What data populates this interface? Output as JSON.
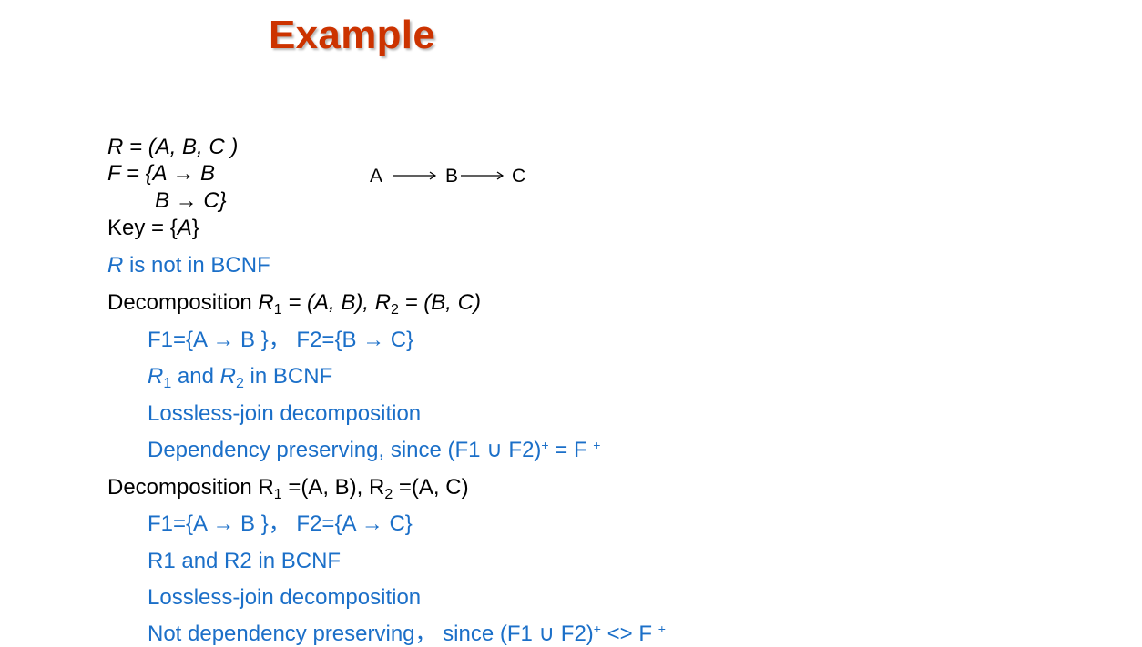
{
  "title": "Example",
  "relation": {
    "r_label": "R",
    "r_rest": " = (A, B, C )",
    "f_label": "F",
    "f_rest": " = {A → B",
    "f_line2": "B → C}",
    "key_text": "Key = {",
    "key_attr": "A",
    "key_close": "}"
  },
  "diagram": {
    "a": "A",
    "b": "B",
    "c": "C"
  },
  "not_bcnf": {
    "r": "R",
    "rest": " is not in BCNF"
  },
  "decomp1": {
    "prefix": "Decomposition ",
    "r1": "R",
    "sub1": "1",
    "mid": " = (A, B), ",
    "r2": "R",
    "sub2": "2",
    "end": " = (B, C)",
    "f_line": "F1={A → B }， F2={B → C}",
    "bcnf_r1": "R",
    "bcnf_sub1": "1",
    "bcnf_and": " and ",
    "bcnf_r2": "R",
    "bcnf_sub2": "2",
    "bcnf_end": " in BCNF",
    "lossless": "Lossless-join decomposition",
    "dep_prefix": "Dependency preserving, since  (F1 ∪ F2)",
    "dep_sup1": "+",
    "dep_mid": " = F ",
    "dep_sup2": "+"
  },
  "decomp2": {
    "prefix": "Decomposition R",
    "sub1": "1",
    "mid": " =(A, B),  R",
    "sub2": "2",
    "end": " =(A, C)",
    "f_line": "F1={A → B }， F2={A → C}",
    "bcnf": "R1 and R2 in BCNF",
    "lossless": "Lossless-join decomposition",
    "dep_prefix": "Not dependency preserving，  since  (F1 ∪ F2)",
    "dep_sup1": "+",
    "dep_mid": " <> F ",
    "dep_sup2": "+"
  }
}
